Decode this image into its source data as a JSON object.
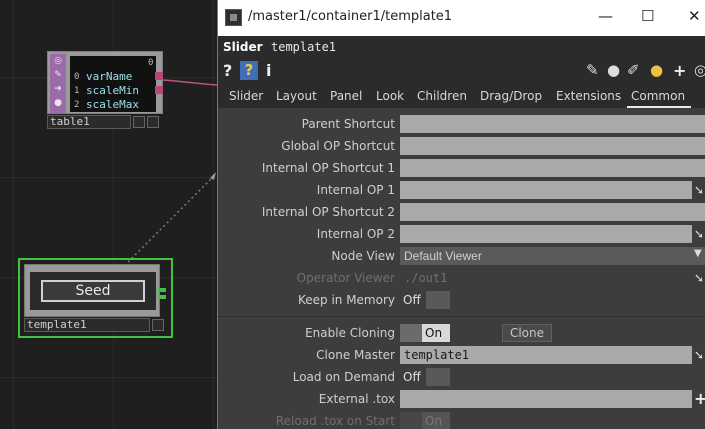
{
  "network": {
    "table_node": {
      "name": "table1",
      "column_header": "0",
      "rows": [
        {
          "index": "0",
          "value": "varName"
        },
        {
          "index": "1",
          "value": "scaleMin"
        },
        {
          "index": "2",
          "value": "scaleMax"
        }
      ]
    },
    "template_node": {
      "name": "template1",
      "button_label": "Seed"
    }
  },
  "window": {
    "title": "/master1/container1/template1",
    "controls": {
      "minimize": "—",
      "maximize": "☐",
      "close": "✕"
    },
    "op_type": "Slider",
    "op_name": "template1",
    "header_icons": {
      "help": "?",
      "help_ext": "?",
      "info": "i",
      "add": "+"
    },
    "tabs": [
      "Slider",
      "Layout",
      "Panel",
      "Look",
      "Children",
      "Drag/Drop",
      "Extensions",
      "Common"
    ],
    "active_tab": "Common",
    "params": {
      "parent_shortcut": {
        "label": "Parent Shortcut",
        "value": ""
      },
      "global_op_shortcut": {
        "label": "Global OP Shortcut",
        "value": ""
      },
      "internal_op_shortcut_1": {
        "label": "Internal OP Shortcut 1",
        "value": ""
      },
      "internal_op_1": {
        "label": "Internal OP 1",
        "value": ""
      },
      "internal_op_shortcut_2": {
        "label": "Internal OP Shortcut 2",
        "value": ""
      },
      "internal_op_2": {
        "label": "Internal OP 2",
        "value": ""
      },
      "node_view": {
        "label": "Node View",
        "value": "Default Viewer"
      },
      "operator_viewer": {
        "label": "Operator Viewer",
        "value": "./out1"
      },
      "keep_in_memory": {
        "label": "Keep in Memory",
        "value": "Off"
      },
      "enable_cloning": {
        "label": "Enable Cloning",
        "value": "On",
        "button": "Clone"
      },
      "clone_master": {
        "label": "Clone Master",
        "value": "template1"
      },
      "load_on_demand": {
        "label": "Load on Demand",
        "value": "Off"
      },
      "external_tox": {
        "label": "External .tox",
        "value": ""
      },
      "reload_tox_on_start": {
        "label": "Reload .tox on Start",
        "value": "On"
      }
    }
  }
}
